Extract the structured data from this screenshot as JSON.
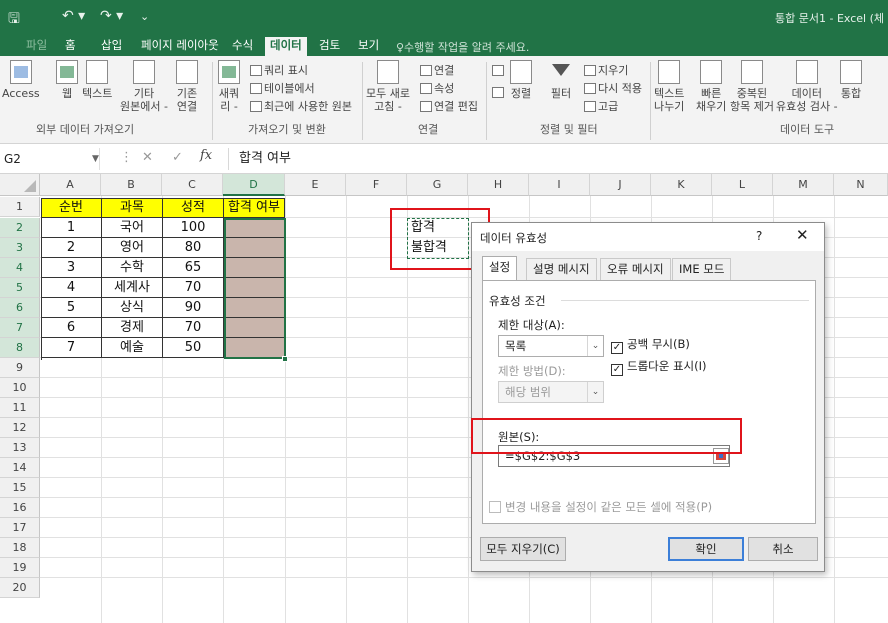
{
  "window": {
    "title": "통합 문서1 - Excel (체",
    "quick_access": {
      "undo_icon": "↶ ▾",
      "redo_icon": "↷ ▾",
      "customize_icon": "⌄"
    }
  },
  "ribbon_tabs": [
    {
      "label": "파일"
    },
    {
      "label": "홈"
    },
    {
      "label": "삽입"
    },
    {
      "label": "페이지 레이아웃"
    },
    {
      "label": "수식"
    },
    {
      "label": "데이터",
      "active": true
    },
    {
      "label": "검토"
    },
    {
      "label": "보기"
    }
  ],
  "tell_me": "♀수행할 작업을 알려 주세요.",
  "ribbon": {
    "external": {
      "access": "Access",
      "web": "웹",
      "text": "텍스트",
      "other1": "기타",
      "other2": "원본에서 -",
      "existing1": "기존",
      "existing2": "연결",
      "group": "외부 데이터 가져오기"
    },
    "transform": {
      "new1": "새쿼",
      "new2": "리 -",
      "show_query": "쿼리 표시",
      "from_table": "테이블에서",
      "recent": "최근에 사용한 원본",
      "group": "가져오기 및 변환"
    },
    "connections": {
      "refresh1": "모두 새로",
      "refresh2": "고침 -",
      "connections": "연결",
      "properties": "속성",
      "edit_links": "연결 편집",
      "group": "연결"
    },
    "sort_filter": {
      "sort": "정렬",
      "filter": "필터",
      "clear": "지우기",
      "reapply": "다시 적용",
      "advanced": "고급",
      "group": "정렬 및 필터"
    },
    "tools": {
      "t1": "텍스트",
      "t2": "나누기",
      "f1": "빠른",
      "f2": "채우기",
      "r1": "중복된",
      "r2": "항목 제거",
      "v1": "데이터",
      "v2": "유효성 검사 -",
      "c1": "통합",
      "group": "데이터 도구"
    }
  },
  "formula_bar": {
    "name_box": "G2",
    "cancel_icon": "✕",
    "enter_icon": "✓",
    "fx": "fx",
    "content": "합격 여부"
  },
  "grid": {
    "columns": [
      "A",
      "B",
      "C",
      "D",
      "E",
      "F",
      "G",
      "H",
      "I",
      "J",
      "K",
      "L",
      "M",
      "N"
    ],
    "rows": [
      "1",
      "2",
      "3",
      "4",
      "5",
      "6",
      "7",
      "8",
      "9",
      "10",
      "11",
      "12",
      "13",
      "14",
      "15",
      "16",
      "17",
      "18",
      "19",
      "20"
    ],
    "headers": [
      "순번",
      "과목",
      "성적",
      "합격 여부"
    ],
    "data": [
      [
        "1",
        "국어",
        "100",
        ""
      ],
      [
        "2",
        "영어",
        "80",
        ""
      ],
      [
        "3",
        "수학",
        "65",
        ""
      ],
      [
        "4",
        "세계사",
        "70",
        ""
      ],
      [
        "5",
        "상식",
        "90",
        ""
      ],
      [
        "6",
        "경제",
        "70",
        ""
      ],
      [
        "7",
        "예술",
        "50",
        ""
      ]
    ],
    "list_values": [
      "합격",
      "불합격"
    ]
  },
  "dialog": {
    "title": "데이터 유효성",
    "help": "?",
    "close": "✕",
    "tabs": [
      "설정",
      "설명 메시지",
      "오류 메시지",
      "IME 모드"
    ],
    "criteria_label": "유효성 조건",
    "allow_label": "제한 대상(A):",
    "allow_value": "목록",
    "ignore_blank": "공백 무시(B)",
    "data_label": "제한 방법(D):",
    "data_value": "해당 범위",
    "dropdown": "드롭다운 표시(I)",
    "source_label": "원본(S):",
    "source_value": "=$G$2:$G$3",
    "apply_all": "변경 내용을 설정이 같은 모든 셀에 적용(P)",
    "clear_all": "모두 지우기(C)",
    "ok": "확인",
    "cancel": "취소"
  },
  "colors": {
    "excel_green": "#217346",
    "header_yellow": "#ffff00",
    "selection_fill": "#c9b5ac",
    "highlight_red": "#e0141b"
  }
}
